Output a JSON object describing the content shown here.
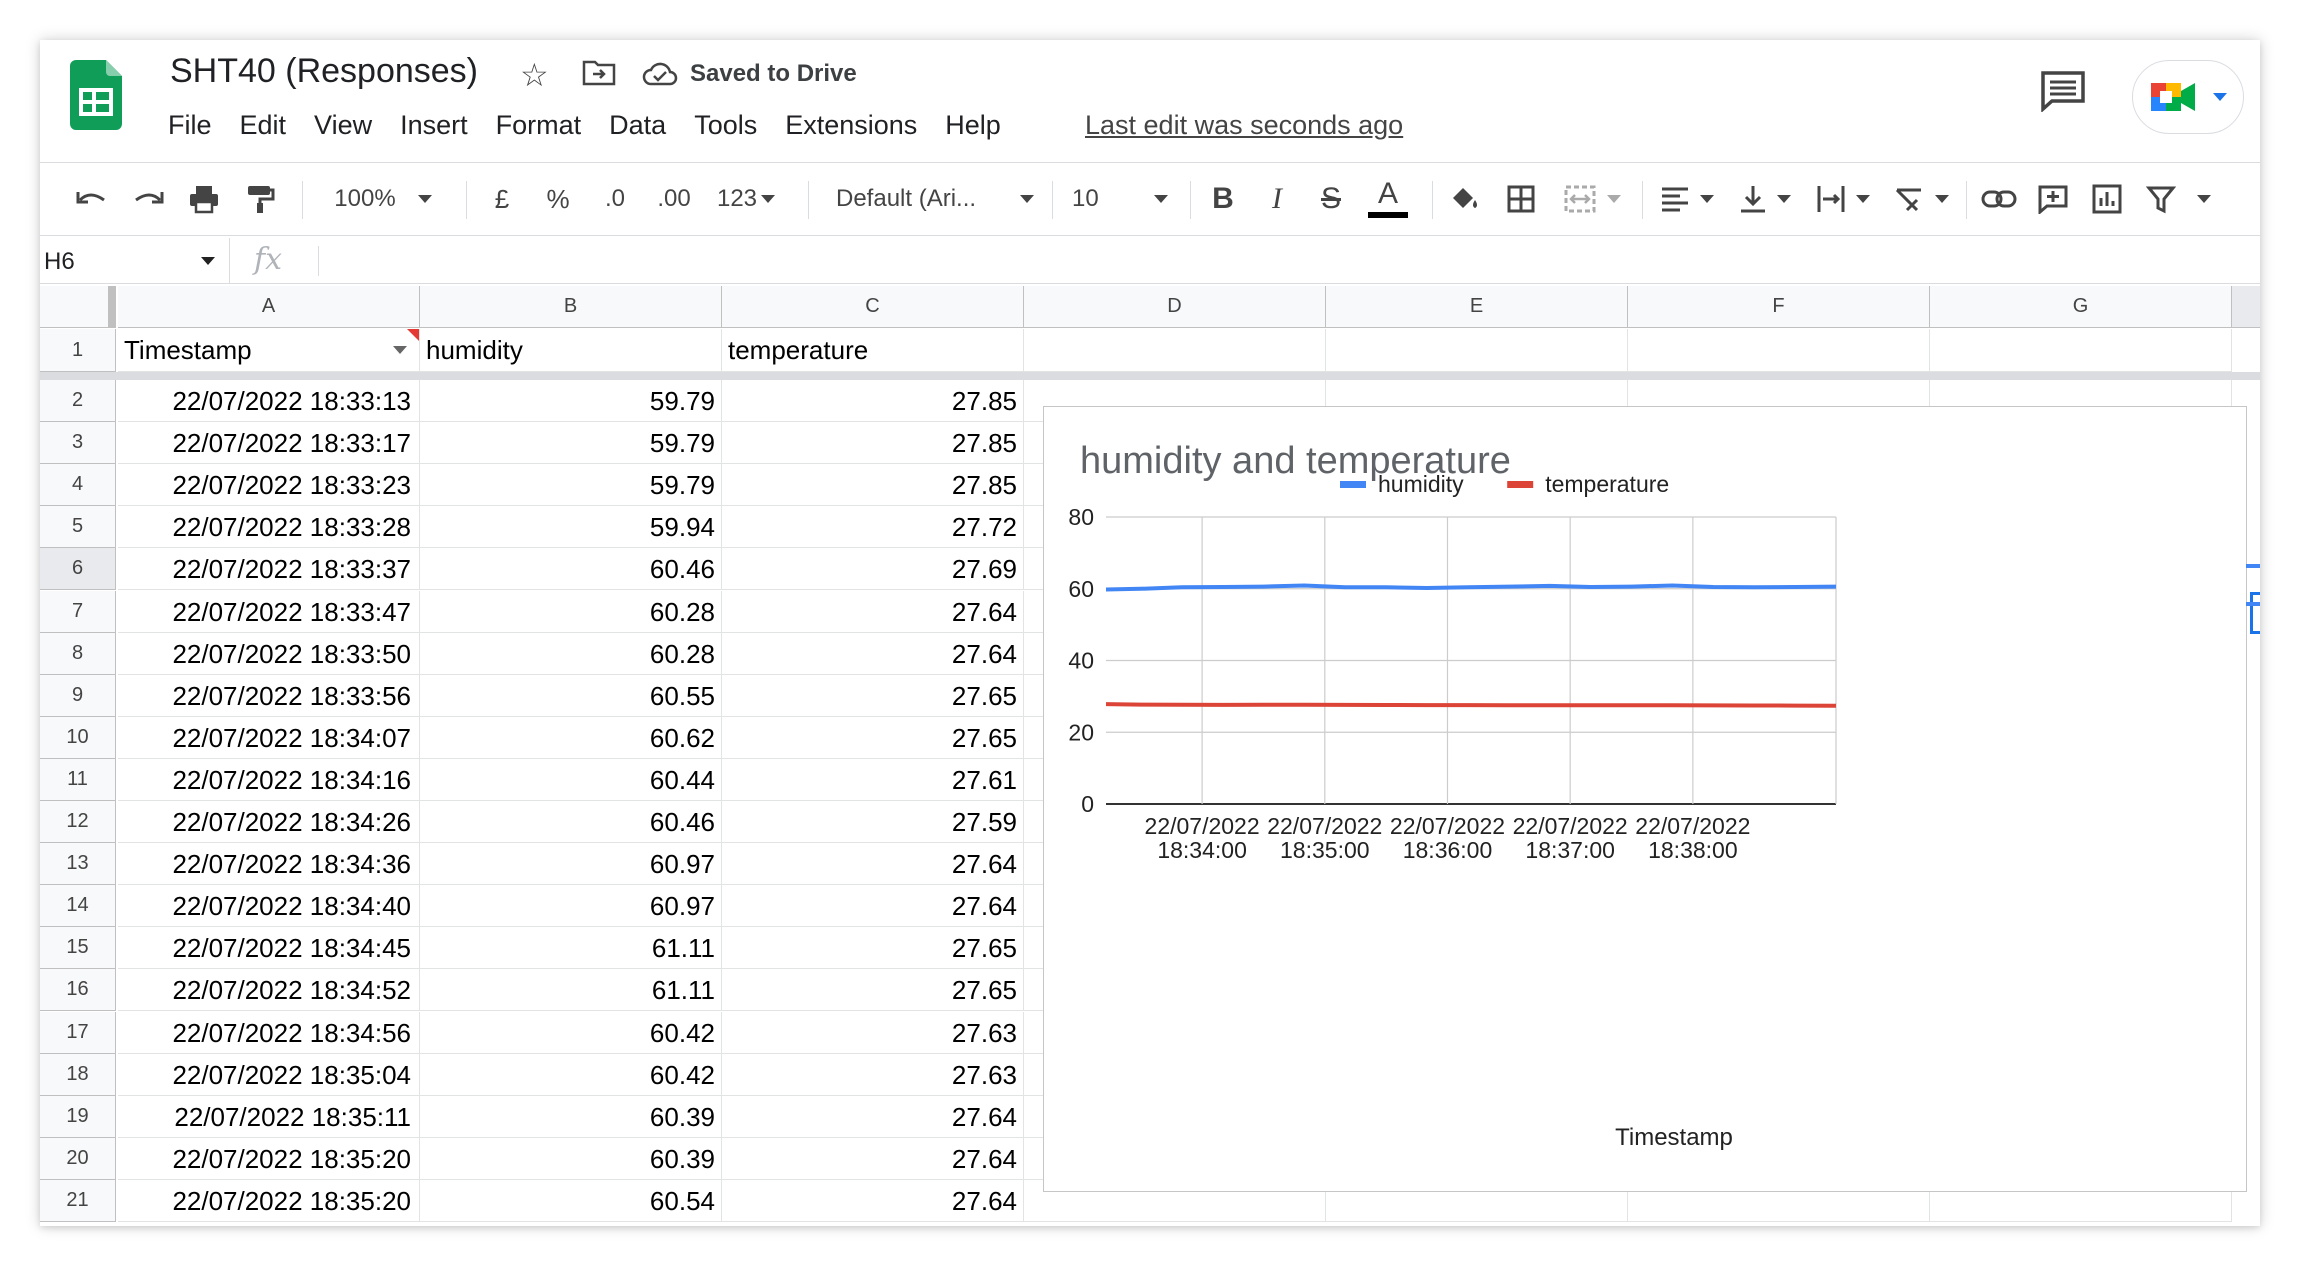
{
  "app": {
    "title": "SHT40 (Responses)",
    "saved_status": "Saved to Drive",
    "last_edit": "Last edit was seconds ago",
    "menu": [
      "File",
      "Edit",
      "View",
      "Insert",
      "Format",
      "Data",
      "Tools",
      "Extensions",
      "Help"
    ]
  },
  "toolbar": {
    "zoom": "100%",
    "currency": "£",
    "percent": "%",
    "dec_less": ".0",
    "dec_more": ".00",
    "more_formats": "123",
    "font": "Default (Ari...",
    "font_size": "10",
    "bold": "B",
    "italic": "I",
    "strike": "S",
    "text_color": "A"
  },
  "formula_bar": {
    "name_box": "H6",
    "fx": "fx"
  },
  "columns": [
    "A",
    "B",
    "C",
    "D",
    "E",
    "F",
    "G"
  ],
  "header_row": {
    "row": "1",
    "cells": [
      "Timestamp",
      "humidity",
      "temperature"
    ]
  },
  "rows": [
    {
      "n": "2",
      "ts": "22/07/2022 18:33:13",
      "h": "59.79",
      "t": "27.85"
    },
    {
      "n": "3",
      "ts": "22/07/2022 18:33:17",
      "h": "59.79",
      "t": "27.85"
    },
    {
      "n": "4",
      "ts": "22/07/2022 18:33:23",
      "h": "59.79",
      "t": "27.85"
    },
    {
      "n": "5",
      "ts": "22/07/2022 18:33:28",
      "h": "59.94",
      "t": "27.72"
    },
    {
      "n": "6",
      "ts": "22/07/2022 18:33:37",
      "h": "60.46",
      "t": "27.69"
    },
    {
      "n": "7",
      "ts": "22/07/2022 18:33:47",
      "h": "60.28",
      "t": "27.64"
    },
    {
      "n": "8",
      "ts": "22/07/2022 18:33:50",
      "h": "60.28",
      "t": "27.64"
    },
    {
      "n": "9",
      "ts": "22/07/2022 18:33:56",
      "h": "60.55",
      "t": "27.65"
    },
    {
      "n": "10",
      "ts": "22/07/2022 18:34:07",
      "h": "60.62",
      "t": "27.65"
    },
    {
      "n": "11",
      "ts": "22/07/2022 18:34:16",
      "h": "60.44",
      "t": "27.61"
    },
    {
      "n": "12",
      "ts": "22/07/2022 18:34:26",
      "h": "60.46",
      "t": "27.59"
    },
    {
      "n": "13",
      "ts": "22/07/2022 18:34:36",
      "h": "60.97",
      "t": "27.64"
    },
    {
      "n": "14",
      "ts": "22/07/2022 18:34:40",
      "h": "60.97",
      "t": "27.64"
    },
    {
      "n": "15",
      "ts": "22/07/2022 18:34:45",
      "h": "61.11",
      "t": "27.65"
    },
    {
      "n": "16",
      "ts": "22/07/2022 18:34:52",
      "h": "61.11",
      "t": "27.65"
    },
    {
      "n": "17",
      "ts": "22/07/2022 18:34:56",
      "h": "60.42",
      "t": "27.63"
    },
    {
      "n": "18",
      "ts": "22/07/2022 18:35:04",
      "h": "60.42",
      "t": "27.63"
    },
    {
      "n": "19",
      "ts": "22/07/2022 18:35:11",
      "h": "60.39",
      "t": "27.64"
    },
    {
      "n": "20",
      "ts": "22/07/2022 18:35:20",
      "h": "60.39",
      "t": "27.64"
    },
    {
      "n": "21",
      "ts": "22/07/2022 18:35:20",
      "h": "60.54",
      "t": "27.64"
    }
  ],
  "colors": {
    "humidity": "#4285f4",
    "temperature": "#db4437",
    "sheets_green": "#0f9d58"
  },
  "chart_data": {
    "type": "line",
    "title": "humidity and temperature",
    "xlabel": "Timestamp",
    "ylabel": "",
    "ylim": [
      0,
      80
    ],
    "yticks": [
      0,
      20,
      40,
      60,
      80
    ],
    "xlim": [
      "18:33:13",
      "18:39:10"
    ],
    "xticks": [
      {
        "time": "18:34:00",
        "label": [
          "22/07/2022",
          "18:34:00"
        ]
      },
      {
        "time": "18:35:00",
        "label": [
          "22/07/2022",
          "18:35:00"
        ]
      },
      {
        "time": "18:36:00",
        "label": [
          "22/07/2022",
          "18:36:00"
        ]
      },
      {
        "time": "18:37:00",
        "label": [
          "22/07/2022",
          "18:37:00"
        ]
      },
      {
        "time": "18:38:00",
        "label": [
          "22/07/2022",
          "18:38:00"
        ]
      }
    ],
    "legend": "top",
    "grid": true,
    "x": [
      "18:33:13",
      "18:33:30",
      "18:33:50",
      "18:34:10",
      "18:34:30",
      "18:34:50",
      "18:35:10",
      "18:35:30",
      "18:35:50",
      "18:36:10",
      "18:36:30",
      "18:36:50",
      "18:37:10",
      "18:37:30",
      "18:37:50",
      "18:38:10",
      "18:38:30",
      "18:38:50",
      "18:39:10"
    ],
    "series": [
      {
        "name": "humidity",
        "color": "#4285f4",
        "values": [
          59.8,
          60.0,
          60.4,
          60.5,
          60.6,
          60.9,
          60.4,
          60.4,
          60.2,
          60.4,
          60.6,
          60.8,
          60.5,
          60.6,
          60.9,
          60.5,
          60.4,
          60.5,
          60.6
        ]
      },
      {
        "name": "temperature",
        "color": "#db4437",
        "values": [
          27.85,
          27.7,
          27.65,
          27.62,
          27.64,
          27.64,
          27.62,
          27.6,
          27.58,
          27.56,
          27.55,
          27.54,
          27.54,
          27.52,
          27.5,
          27.48,
          27.46,
          27.44,
          27.4
        ]
      }
    ]
  }
}
